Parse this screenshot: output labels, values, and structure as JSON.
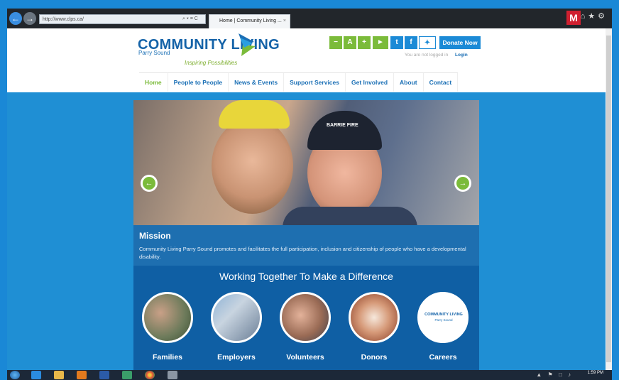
{
  "browser": {
    "address": "http://www.clps.ca/",
    "address_controls": "⌕ ▾ ≡ C",
    "tab_title": "Home | Community Living ...",
    "tab_close": "×",
    "back": "←",
    "forward": "→",
    "right_icons": "⌂★⚙"
  },
  "site": {
    "logo_title": "COMMUNITY LIVING",
    "logo_sub": "Parry Sound",
    "tagline": "Inspiring Possibilities",
    "util": {
      "minus": "−",
      "font": "A",
      "plus": "+",
      "megaphone": "📢",
      "twitter": "t",
      "facebook": "f",
      "donate": "Donate Now"
    },
    "login_status": "You are not logged in",
    "login_link": "Login",
    "menu": [
      "Home",
      "People to People",
      "News & Events",
      "Support Services",
      "Get Involved",
      "About",
      "Contact"
    ]
  },
  "hero": {
    "prev_arrow": "←",
    "next_arrow": "→",
    "cap_text": "BARRIE FIRE"
  },
  "mission": {
    "title": "Mission",
    "text": "Community Living Parry Sound promotes and facilitates the full participation, inclusion and citizenship of people who have a developmental disability."
  },
  "working_together": {
    "title": "Working Together To Make a Difference",
    "items": [
      "Families",
      "Employers",
      "Volunteers",
      "Donors",
      "Careers"
    ]
  },
  "careers_logo": {
    "title": "COMMUNITY LIVING",
    "sub": "Parry Sound"
  },
  "taskbar": {
    "time": "1:59 PM",
    "tray": "▲ ⚑ □ ♪"
  },
  "colors": {
    "brand_blue": "#1563a8",
    "brand_green": "#7bbb3a",
    "page_blue": "#1f8fd4"
  }
}
